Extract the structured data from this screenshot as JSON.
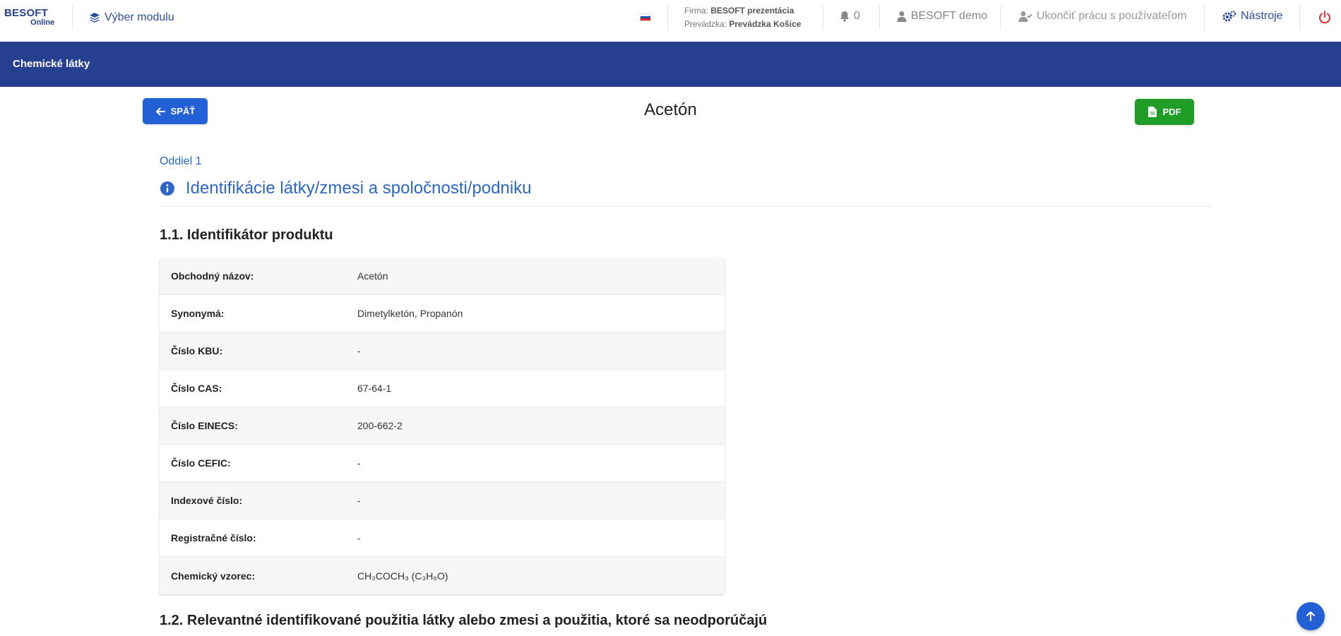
{
  "header": {
    "logo_brand": "BESOFT",
    "logo_sub": "Online",
    "module_label": "Výber modulu",
    "firm_label": "Firma:",
    "firm_value": "BESOFT prezentácia",
    "branch_label": "Prevádzka:",
    "branch_value": "Prevádzka Košice",
    "notifications_count": "0",
    "user_name": "BESOFT demo",
    "end_user_label": "Ukončiť prácu s používateľom",
    "tools_label": "Nástroje"
  },
  "strip": {
    "title": "Chemické látky"
  },
  "actions": {
    "back_label": "SPÄŤ",
    "pdf_label": "PDF"
  },
  "page": {
    "title": "Acetón"
  },
  "section": {
    "number": "Oddiel 1",
    "title": "Identifikácie látky/zmesi a spoločnosti/podniku",
    "subsection1": "1.1. Identifikátor produktu",
    "subsection2": "1.2. Relevantné identifikované použitia látky alebo zmesi a použitia, ktoré sa neodporúčajú"
  },
  "table": [
    {
      "label": "Obchodný názov:",
      "value": "Acetón"
    },
    {
      "label": "Synonymá:",
      "value": "Dimetylketón, Propanón"
    },
    {
      "label": "Číslo KBU:",
      "value": "-"
    },
    {
      "label": "Číslo CAS:",
      "value": "67-64-1"
    },
    {
      "label": "Číslo EINECS:",
      "value": "200-662-2"
    },
    {
      "label": "Číslo CEFIC:",
      "value": "-"
    },
    {
      "label": "Indexové číslo:",
      "value": "-"
    },
    {
      "label": "Registračné číslo:",
      "value": "-"
    },
    {
      "label": "Chemický vzorec:",
      "value": "CH₃COCH₃ (C₃H₆O)"
    }
  ],
  "colors": {
    "primary": "#263f8f",
    "button_blue": "#2360d6",
    "button_green": "#1f9d27",
    "section_blue": "#2a67c9",
    "power_red": "#e53935"
  },
  "icons": [
    "layers-icon",
    "flag-sk-icon",
    "bell-icon",
    "user-icon",
    "user-check-icon",
    "cogs-icon",
    "power-icon",
    "arrow-left-icon",
    "file-icon",
    "info-icon",
    "arrow-up-icon"
  ]
}
